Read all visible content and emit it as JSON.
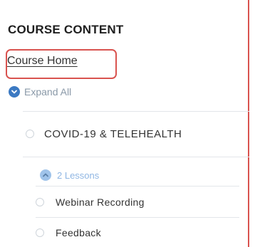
{
  "sidebar": {
    "heading": "COURSE CONTENT",
    "course_home": "Course Home",
    "expand_all": "Expand All",
    "section": {
      "title": "COVID-19 & TELEHEALTH",
      "lessons_toggle": "2 Lessons",
      "items": [
        {
          "title": "Webinar Recording"
        },
        {
          "title": "Feedback"
        }
      ]
    }
  },
  "colors": {
    "highlight_border": "#d9534f",
    "accent_blue": "#3b79c2",
    "light_blue": "#9fc3ea"
  },
  "icons": {
    "expand_all": "chevron-down-circle-icon",
    "lessons": "chevron-up-circle-icon",
    "item_status": "empty-circle-icon"
  }
}
